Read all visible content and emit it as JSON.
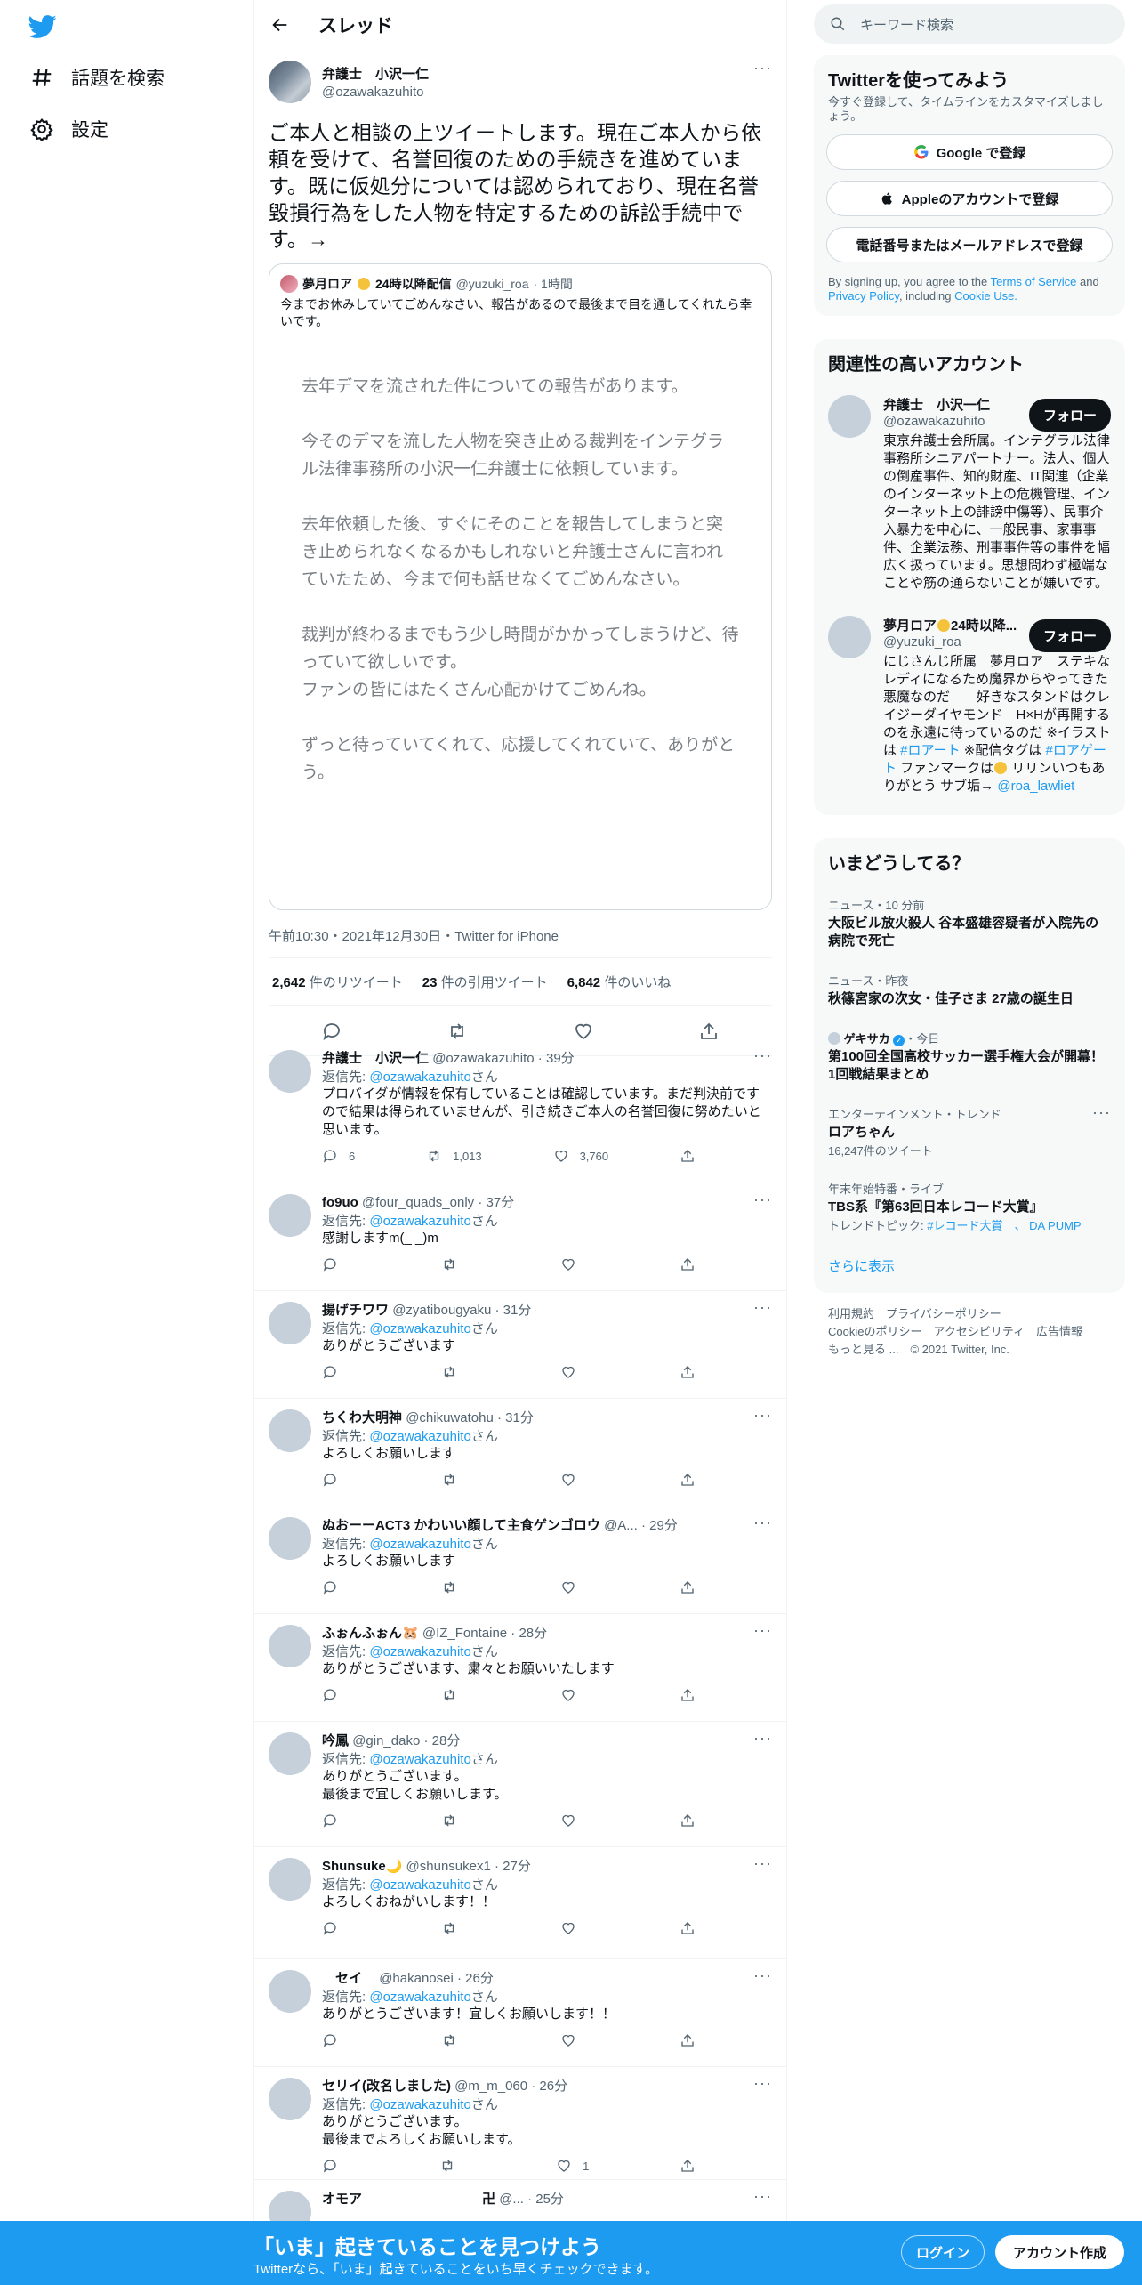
{
  "nav": {
    "explore": "話題を検索",
    "settings": "設定"
  },
  "header": {
    "title": "スレッド"
  },
  "tweet": {
    "name": "弁護士　小沢一仁",
    "handle": "@ozawakazuhito",
    "text": "ご本人と相談の上ツイートします。現在ご本人から依頼を受けて、名誉回復のための手続きを進めています。既に仮処分については認められており、現在名誉毀損行為をした人物を特定するための訴訟手続中です。→",
    "quote": {
      "name_a": "夢月ロア",
      "name_b": "24時以降配信",
      "handle": "@yuzuki_roa",
      "time": "· 1時間",
      "text": "今までお休みしていてごめんなさい、報告があるので最後まで目を通してくれたら幸いです。",
      "image_paragraphs": [
        "去年デマを流された件についての報告があります。",
        "今そのデマを流した人物を突き止める裁判をインテグラル法律事務所の小沢一仁弁護士に依頼しています。",
        "去年依頼した後、すぐにそのことを報告してしまうと突き止められなくなるかもしれないと弁護士さんに言われていたため、今まで何も話せなくてごめんなさい。",
        "裁判が終わるまでもう少し時間がかかってしまうけど、待っていて欲しいです。\nファンの皆にはたくさん心配かけてごめんね。",
        "ずっと待っていてくれて、応援してくれていて、ありがとう。"
      ]
    },
    "meta": "午前10:30・2021年12月30日・Twitter for iPhone",
    "retweets_num": "2,642",
    "retweets_label": "件のリツイート",
    "quotes_num": "23",
    "quotes_label": "件の引用ツイート",
    "likes_num": "6,842",
    "likes_label": "件のいいね"
  },
  "replying_label": "返信先: ",
  "replying_handle": "@ozawakazuhito",
  "replying_suffix": "さん",
  "replies": [
    {
      "name": "弁護士　小沢一仁",
      "handle": "@ozawakazuhito · 39分",
      "text": "プロバイダが情報を保有していることは確認しています。まだ判決前ですので結果は得られていませんが、引き続きご本人の名誉回復に努めたいと思います。",
      "reply_count": "6",
      "rt_count": "1,013",
      "like_count": "3,760"
    },
    {
      "name": "fo9uo",
      "handle": "@four_quads_only · 37分",
      "text": "感謝しますm(_ _)m",
      "reply_count": "",
      "rt_count": "",
      "like_count": ""
    },
    {
      "name": "揚げチワワ",
      "handle": "@zyatibougyaku · 31分",
      "text": "ありがとうございます",
      "reply_count": "",
      "rt_count": "",
      "like_count": ""
    },
    {
      "name": "ちくわ大明神",
      "handle": "@chikuwatohu · 31分",
      "text": "よろしくお願いします",
      "reply_count": "",
      "rt_count": "",
      "like_count": ""
    },
    {
      "name": "ぬおーーACT3 かわいい顔して主食ゲンゴロウ",
      "handle": "@A... · 29分",
      "text": "よろしくお願いします",
      "reply_count": "",
      "rt_count": "",
      "like_count": ""
    },
    {
      "name": "ふぉんふぉん🐹",
      "handle": "@IZ_Fontaine · 28分",
      "text": "ありがとうございます、粛々とお願いいたします",
      "reply_count": "",
      "rt_count": "",
      "like_count": ""
    },
    {
      "name": "吟鳳",
      "handle": "@gin_dako · 28分",
      "text": "ありがとうございます。\n最後まで宜しくお願いします。",
      "reply_count": "",
      "rt_count": "",
      "like_count": ""
    },
    {
      "name": "Shunsuke🌙",
      "handle": "@shunsukex1 · 27分",
      "text": "よろしくおねがいします！！",
      "reply_count": "",
      "rt_count": "",
      "like_count": ""
    },
    {
      "name": "　セイ　",
      "handle": "@hakanosei · 26分",
      "text": "ありがとうございます！宜しくお願いします！！",
      "reply_count": "",
      "rt_count": "",
      "like_count": ""
    },
    {
      "name": "セリイ(改名しました)",
      "handle": "@m_m_060 · 26分",
      "text": "ありがとうございます。\n最後までよろしくお願いします。",
      "reply_count": "",
      "rt_count": "",
      "like_count": "1"
    },
    {
      "name": "オモア　　　　　　　　　卍",
      "handle": "@... · 25分",
      "text": "",
      "reply_count": "",
      "rt_count": "",
      "like_count": ""
    }
  ],
  "search": {
    "placeholder": "キーワード検索"
  },
  "signup_panel": {
    "title": "Twitterを使ってみよう",
    "sub": "今すぐ登録して、タイムラインをカスタマイズしましょう。",
    "google": "Google で登録",
    "apple": "Appleのアカウントで登録",
    "phone": "電話番号またはメールアドレスで登録",
    "legal_a": "By signing up, you agree to the ",
    "terms": "Terms of Service",
    "legal_b": " and ",
    "privacy": "Privacy Policy",
    "legal_c": ", including ",
    "cookie": "Cookie Use.",
    "google_colors": [
      "#4285f4",
      "#ea4335",
      "#fbbc05",
      "#34a853"
    ]
  },
  "related": {
    "title": "関連性の高いアカウント",
    "follow": "フォロー",
    "accounts": [
      {
        "name": "弁護士　小沢一仁",
        "handle": "@ozawakazuhito",
        "bio": "東京弁護士会所属。インテグラル法律事務所シニアパートナー。法人、個人の倒産事件、知的財産、IT関連（企業のインターネット上の危機管理、インターネット上の誹謗中傷等）、民事介入暴力を中心に、一般民事、家事事件、企業法務、刑事事件等の事件を幅広く扱っています。思想問わず極端なことや筋の通らないことが嫌いです。"
      },
      {
        "name_a": "夢月ロア",
        "name_b": "24時以降...",
        "handle": "@yuzuki_roa",
        "bio_a": "にじさんじ所属　夢月ロア　ステキなレディになるため魔界からやってきた悪魔なのだ　　好きなスタンドはクレイジーダイヤモンド　H×Hが再開するのを永遠に待っているのだ ※イラストは ",
        "bio_tag1": "#ロアート",
        "bio_b": " ※配信タグは ",
        "bio_tag2": "#ロアゲート",
        "bio_c": " ファンマークは",
        "bio_d": " リリンいつもありがとう サブ垢→ ",
        "bio_link": "@roa_lawliet"
      }
    ]
  },
  "trends": {
    "title": "いまどうしてる？",
    "items": [
      {
        "cat": "ニュース・10 分前",
        "title": "大阪ビル放火殺人 谷本盛雄容疑者が入院先の病院で死亡"
      },
      {
        "cat": "ニュース・昨夜",
        "title": "秋篠宮家の次女・佳子さま 27歳の誕生日"
      },
      {
        "cat": "ゲキサカ",
        "cat2": "・今日",
        "title": "第100回全国高校サッカー選手権大会が開幕！1回戦結果まとめ"
      },
      {
        "cat": "エンターテインメント・トレンド",
        "title": "ロアちゃん",
        "sub": "16,247件のツイート"
      },
      {
        "cat": "年末年始特番・ライブ",
        "title": "TBS系『第63回日本レコード大賞』",
        "sub_a": "トレンドトピック: ",
        "sub_link": "#レコード大賞　、 DA PUMP"
      }
    ],
    "more": "さらに表示"
  },
  "footer": {
    "line1": "利用規約　プライバシーポリシー",
    "line2": "Cookieのポリシー　アクセシビリティ　広告情報",
    "line3": "もっと見る ...　© 2021 Twitter, Inc."
  },
  "bottom_bar": {
    "title": "「いま」起きていることを見つけよう",
    "sub": "Twitterなら、「いま」起きていることをいち早くチェックできます。",
    "login": "ログイン",
    "signup": "アカウント作成"
  },
  "colors": {
    "brand": "#1d9bf0",
    "text": "#0f1419",
    "muted": "#536471"
  }
}
